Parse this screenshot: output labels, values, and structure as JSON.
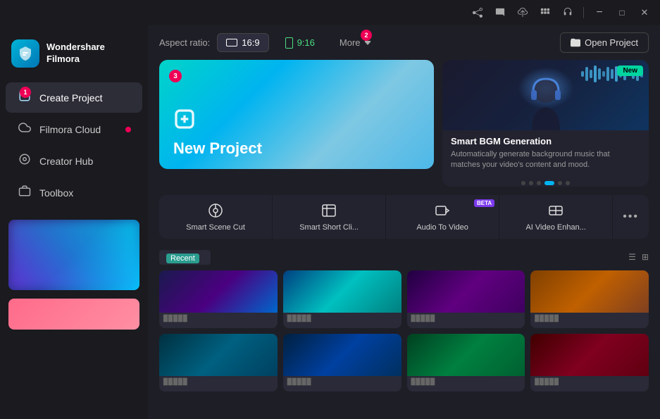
{
  "titlebar": {
    "icons": [
      "share-icon",
      "message-icon",
      "cloud-icon",
      "grid-icon",
      "headset-icon"
    ],
    "min_label": "−",
    "max_label": "□",
    "close_label": "✕"
  },
  "sidebar": {
    "logo_line1": "Wondershare",
    "logo_line2": "Filmora",
    "items": [
      {
        "id": "create-project",
        "label": "Create Project",
        "icon": "➕",
        "active": true,
        "badge": "1"
      },
      {
        "id": "filmora-cloud",
        "label": "Filmora Cloud",
        "icon": "☁",
        "dot": true
      },
      {
        "id": "creator-hub",
        "label": "Creator Hub",
        "icon": "◎"
      },
      {
        "id": "toolbox",
        "label": "Toolbox",
        "icon": "🔧"
      }
    ]
  },
  "toolbar": {
    "aspect_label": "Aspect ratio:",
    "badge2": "2",
    "btn_169": "16:9",
    "btn_916": "9:16",
    "more_label": "More",
    "open_project_label": "Open Project"
  },
  "new_project": {
    "badge3": "3",
    "title": "New Project",
    "plus_icon": "⊕"
  },
  "bgm_card": {
    "new_badge": "New",
    "title": "Smart BGM Generation",
    "description": "Automatically generate background music that matches your video's content and mood.",
    "dots": [
      false,
      false,
      false,
      true,
      false,
      false
    ]
  },
  "ai_tools": [
    {
      "id": "smart-scene-cut",
      "label": "Smart Scene Cut",
      "icon": "⊙",
      "beta": false
    },
    {
      "id": "smart-short-clip",
      "label": "Smart Short Cli...",
      "icon": "⊡",
      "beta": false
    },
    {
      "id": "audio-to-video",
      "label": "Audio To Video",
      "icon": "⊟",
      "beta": true
    },
    {
      "id": "ai-video-enhance",
      "label": "AI Video Enhan...",
      "icon": "⊞",
      "beta": false
    },
    {
      "id": "more",
      "label": "•••",
      "icon": "···",
      "beta": false
    }
  ],
  "recent": {
    "label": "Recent",
    "actions": [
      "list-icon",
      "grid-icon"
    ]
  },
  "thumbnails_row1": [
    {
      "id": "thumb1",
      "color_class": "thumb-1",
      "label": "Project 1"
    },
    {
      "id": "thumb2",
      "color_class": "thumb-2",
      "label": "Project 2"
    },
    {
      "id": "thumb3",
      "color_class": "thumb-3",
      "label": "Project 3"
    },
    {
      "id": "thumb4",
      "color_class": "thumb-4",
      "label": "Project 4"
    }
  ],
  "thumbnails_row2": [
    {
      "id": "thumb5",
      "color_class": "thumb-5",
      "label": "Project 5"
    },
    {
      "id": "thumb6",
      "color_class": "thumb-6",
      "label": "Project 6"
    },
    {
      "id": "thumb7",
      "color_class": "thumb-7",
      "label": "Project 7"
    },
    {
      "id": "thumb8",
      "color_class": "thumb-8",
      "label": "Project 8"
    }
  ]
}
